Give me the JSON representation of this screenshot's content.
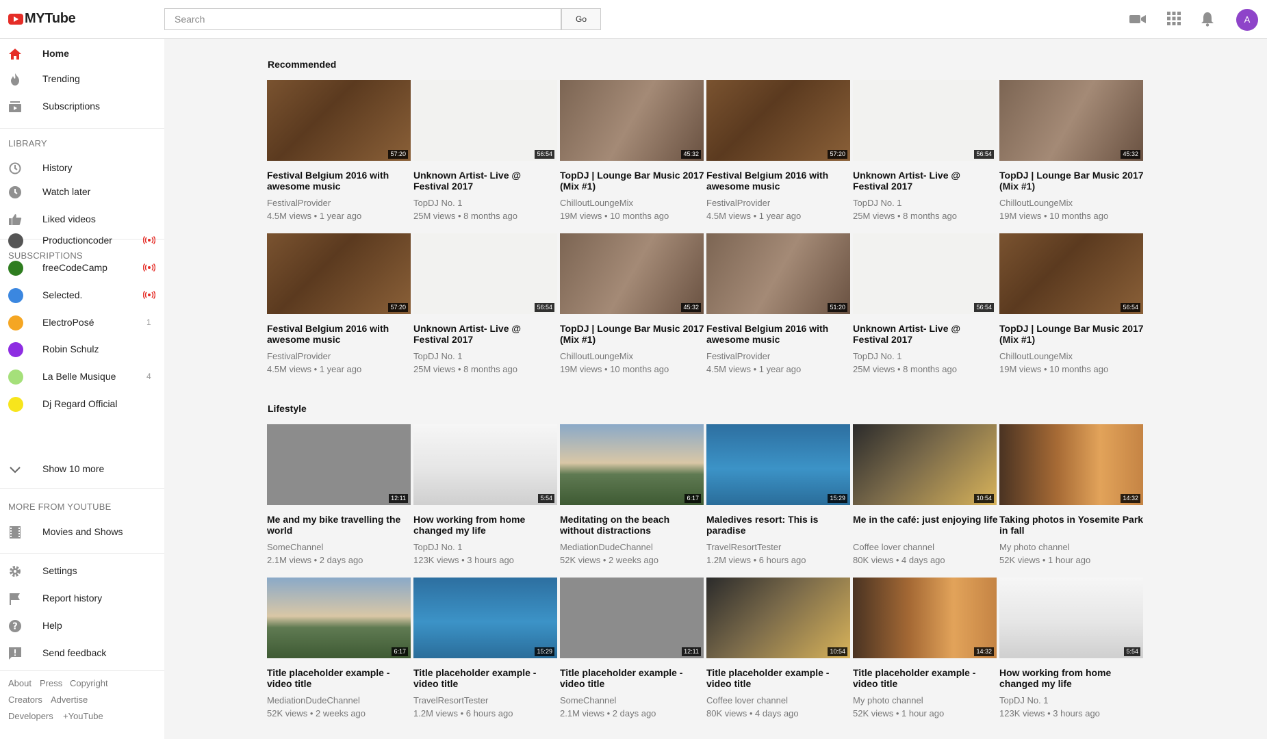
{
  "app": {
    "name": "MYTube"
  },
  "search": {
    "placeholder": "Search",
    "button_label": "Go"
  },
  "user": {
    "initial": "A"
  },
  "sidebar": {
    "main_items": [
      {
        "label": "Home",
        "icon": "home-icon"
      },
      {
        "label": "Trending",
        "icon": "flame-icon"
      },
      {
        "label": "Subscriptions",
        "icon": "subscriptions-icon"
      }
    ],
    "library_heading": "LIBRARY",
    "library_items": [
      {
        "label": "History",
        "icon": "history-icon"
      },
      {
        "label": "Watch later",
        "icon": "clock-icon"
      },
      {
        "label": "Liked videos",
        "icon": "thumbs-up-icon"
      }
    ],
    "subscriptions_heading": "SUBSCRIPTIONS",
    "subscriptions": [
      {
        "label": "Productioncoder",
        "color": "#555555",
        "live": true,
        "count": ""
      },
      {
        "label": "freeCodeCamp",
        "color": "#2e7d1f",
        "live": true,
        "count": ""
      },
      {
        "label": "Selected.",
        "color": "#3b87e0",
        "live": true,
        "count": ""
      },
      {
        "label": "ElectroPosé",
        "color": "#f5a623",
        "live": false,
        "count": "1"
      },
      {
        "label": "Robin Schulz",
        "color": "#8e2de2",
        "live": false,
        "count": ""
      },
      {
        "label": "La Belle Musique",
        "color": "#a5e07a",
        "live": false,
        "count": "4"
      },
      {
        "label": "Dj Regard Official",
        "color": "#f7e51c",
        "live": false,
        "count": ""
      }
    ],
    "show_more_label": "Show 10 more",
    "more_heading": "MORE FROM YOUTUBE",
    "more_items": [
      {
        "label": "Movies and Shows",
        "icon": "film-icon"
      }
    ],
    "settings_items": [
      {
        "label": "Settings",
        "icon": "gear-icon"
      },
      {
        "label": "Report history",
        "icon": "flag-icon"
      },
      {
        "label": "Help",
        "icon": "help-icon"
      },
      {
        "label": "Send feedback",
        "icon": "feedback-icon"
      }
    ],
    "footer_links": [
      [
        "About",
        "Press",
        "Copyright"
      ],
      [
        "Creators",
        "Advertise"
      ],
      [
        "Developers",
        "+YouTube"
      ]
    ]
  },
  "sections": [
    {
      "title": "Recommended",
      "videos": [
        {
          "title": "Festival Belgium 2016 with awesome music",
          "channel": "FestivalProvider",
          "meta": "4.5M views • 1 year ago",
          "duration": "57:20",
          "thumb": "laptop"
        },
        {
          "title": "Unknown Artist- Live @ Festival 2017",
          "channel": "TopDJ No. 1",
          "meta": "25M views • 8 months ago",
          "duration": "56:54",
          "thumb": "fruit"
        },
        {
          "title": "TopDJ | Lounge Bar Music 2017 (Mix #1)",
          "channel": "ChilloutLoungeMix",
          "meta": "19M views • 10 months ago",
          "duration": "45:32",
          "thumb": "coffee"
        },
        {
          "title": "Festival Belgium 2016 with awesome music",
          "channel": "FestivalProvider",
          "meta": "4.5M views • 1 year ago",
          "duration": "57:20",
          "thumb": "laptop"
        },
        {
          "title": "Unknown Artist- Live @ Festival 2017",
          "channel": "TopDJ No. 1",
          "meta": "25M views • 8 months ago",
          "duration": "56:54",
          "thumb": "fruit"
        },
        {
          "title": "TopDJ | Lounge Bar Music 2017 (Mix #1)",
          "channel": "ChilloutLoungeMix",
          "meta": "19M views • 10 months ago",
          "duration": "45:32",
          "thumb": "coffee"
        },
        {
          "title": "Festival Belgium 2016 with awesome music",
          "channel": "FestivalProvider",
          "meta": "4.5M views • 1 year ago",
          "duration": "57:20",
          "thumb": "laptop"
        },
        {
          "title": "Unknown Artist- Live @ Festival 2017",
          "channel": "TopDJ No. 1",
          "meta": "25M views • 8 months ago",
          "duration": "56:54",
          "thumb": "fruit"
        },
        {
          "title": "TopDJ | Lounge Bar Music 2017 (Mix #1)",
          "channel": "ChilloutLoungeMix",
          "meta": "19M views • 10 months ago",
          "duration": "45:32",
          "thumb": "coffee"
        },
        {
          "title": "Festival Belgium 2016 with awesome music",
          "channel": "FestivalProvider",
          "meta": "4.5M views • 1 year ago",
          "duration": "51:20",
          "thumb": "coffee"
        },
        {
          "title": "Unknown Artist- Live @ Festival 2017",
          "channel": "TopDJ No. 1",
          "meta": "25M views • 8 months ago",
          "duration": "56:54",
          "thumb": "fruit"
        },
        {
          "title": "TopDJ | Lounge Bar Music 2017 (Mix #1)",
          "channel": "ChilloutLoungeMix",
          "meta": "19M views • 10 months ago",
          "duration": "56:54",
          "thumb": "laptop"
        }
      ]
    },
    {
      "title": "Lifestyle",
      "videos": [
        {
          "title": "Me and my bike travelling the world",
          "channel": "SomeChannel",
          "meta": "2.1M views • 2 days ago",
          "duration": "12:11",
          "thumb": "bike"
        },
        {
          "title": "How working from home changed my life",
          "channel": "TopDJ No. 1",
          "meta": "123K views • 3 hours ago",
          "duration": "5:54",
          "thumb": "desk"
        },
        {
          "title": "Meditating on the beach without distractions",
          "channel": "MediationDudeChannel",
          "meta": "52K views • 2 weeks ago",
          "duration": "6:17",
          "thumb": "beach"
        },
        {
          "title": "Maledives resort: This is paradise",
          "channel": "TravelResortTester",
          "meta": "1.2M views • 6 hours ago",
          "duration": "15:29",
          "thumb": "pier"
        },
        {
          "title": "Me in the café: just enjoying life",
          "channel": "Coffee lover channel",
          "meta": "80K views • 4 days ago",
          "duration": "10:54",
          "thumb": "cafe"
        },
        {
          "title": "Taking photos in Yosemite Park in fall",
          "channel": "My photo channel",
          "meta": "52K views • 1 hour ago",
          "duration": "14:32",
          "thumb": "forest"
        },
        {
          "title": "Title placeholder example - video title",
          "channel": "MediationDudeChannel",
          "meta": "52K views • 2 weeks ago",
          "duration": "6:17",
          "thumb": "beach"
        },
        {
          "title": "Title placeholder example - video title",
          "channel": "TravelResortTester",
          "meta": "1.2M views • 6 hours ago",
          "duration": "15:29",
          "thumb": "pier"
        },
        {
          "title": "Title placeholder example - video title",
          "channel": "SomeChannel",
          "meta": "2.1M views • 2 days ago",
          "duration": "12:11",
          "thumb": "bike"
        },
        {
          "title": "Title placeholder example - video title",
          "channel": "Coffee lover channel",
          "meta": "80K views • 4 days ago",
          "duration": "10:54",
          "thumb": "cafe"
        },
        {
          "title": "Title placeholder example - video title",
          "channel": "My photo channel",
          "meta": "52K views • 1 hour ago",
          "duration": "14:32",
          "thumb": "forest"
        },
        {
          "title": "How working from home changed my life",
          "channel": "TopDJ No. 1",
          "meta": "123K views • 3 hours ago",
          "duration": "5:54",
          "thumb": "desk"
        }
      ]
    }
  ]
}
